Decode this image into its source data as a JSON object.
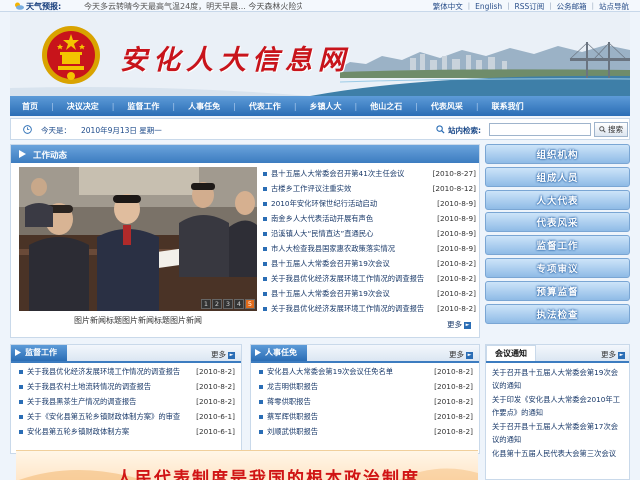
{
  "topbar": {
    "weather_label": "天气预报:",
    "weather_text": "今天多云转晴今天最高气温24度，明天早晨... 今天森林火险灾...",
    "links": [
      "繁体中文",
      "English",
      "RSS订阅",
      "公务邮箱",
      "站点导航"
    ]
  },
  "banner": {
    "site_title": "安化人大信息网"
  },
  "nav": {
    "items": [
      "首页",
      "决议决定",
      "监督工作",
      "人事任免",
      "代表工作",
      "乡镇人大",
      "他山之石",
      "代表风采",
      "联系我们"
    ]
  },
  "date": {
    "label": "今天是：",
    "value": "2010年9月13日 星期一"
  },
  "search": {
    "label": "站内检索:",
    "placeholder": "",
    "button": "搜索"
  },
  "work_news": {
    "title": "工作动态",
    "photo_pages": [
      "1",
      "2",
      "3",
      "4",
      "5"
    ],
    "active_page": 5,
    "photo_caption": "图片新闻标题图片新闻标题图片新闻",
    "items": [
      {
        "title": "县十五届人大常委会召开第41次主任会议",
        "date": "[2010-8-27]"
      },
      {
        "title": "古楼乡工作评议注重实效",
        "date": "[2010-8-12]"
      },
      {
        "title": "2010年安化环保世纪行活动启动",
        "date": "[2010-8-9]"
      },
      {
        "title": "南金乡人大代表活动开展有声色",
        "date": "[2010-8-9]"
      },
      {
        "title": "沿溪镇人大“民情直达”直通民心",
        "date": "[2010-8-9]"
      },
      {
        "title": "市人大检查我县国家惠农政策落实情况",
        "date": "[2010-8-9]"
      },
      {
        "title": "县十五届人大常委会召开第19次会议",
        "date": "[2010-8-2]"
      },
      {
        "title": "关于我县优化经济发展环境工作情况的调查报告",
        "date": "[2010-8-2]"
      },
      {
        "title": "县十五届人大常委会召开第19次会议",
        "date": "[2010-8-2]"
      },
      {
        "title": "关于我县优化经济发展环境工作情况的调查报告",
        "date": "[2010-8-2]"
      }
    ],
    "more": "更多"
  },
  "sidebar": {
    "buttons": [
      "组织机构",
      "组成人员",
      "人大代表",
      "代表风采",
      "监督工作",
      "专项审议",
      "预算监督",
      "执法检查"
    ]
  },
  "supervision": {
    "title": "监督工作",
    "more": "更多",
    "items": [
      {
        "title": "关于我县优化经济发展环境工作情况的调查报告",
        "date": "[2010-8-2]"
      },
      {
        "title": "关于我县农村土地流转情况的调查报告",
        "date": "[2010-8-2]"
      },
      {
        "title": "关于我县黑茶生产情况的调查报告",
        "date": "[2010-8-2]"
      },
      {
        "title": "关于《安化县第五轮乡镇财政体制方案》的审查",
        "date": "[2010-6-1]"
      },
      {
        "title": "安化县第五轮乡镇财政体制方案",
        "date": "[2010-6-1]"
      }
    ]
  },
  "personnel": {
    "title": "人事任免",
    "more": "更多",
    "items": [
      {
        "title": "安化县人大常委会第19次会议任免名单",
        "date": "[2010-8-2]"
      },
      {
        "title": "龙吉明供职报告",
        "date": "[2010-8-2]"
      },
      {
        "title": "蒋零供职报告",
        "date": "[2010-8-2]"
      },
      {
        "title": "蔡军辉供职报告",
        "date": "[2010-8-2]"
      },
      {
        "title": "刘顺武供职报告",
        "date": "[2010-8-2]"
      }
    ]
  },
  "notice": {
    "title": "会议通知",
    "more": "更多",
    "items": [
      "关于召开县十五届人大常委会第19次会议的通知",
      "关于印发《安化县人大常委会2010年工作要点》的通知",
      "关于召开县十五届人大常委会第17次会议的通知",
      "化县第十五届人民代表大会第三次会议"
    ]
  },
  "slogan": {
    "text": "人民代表制度是我国的根本政治制度"
  }
}
